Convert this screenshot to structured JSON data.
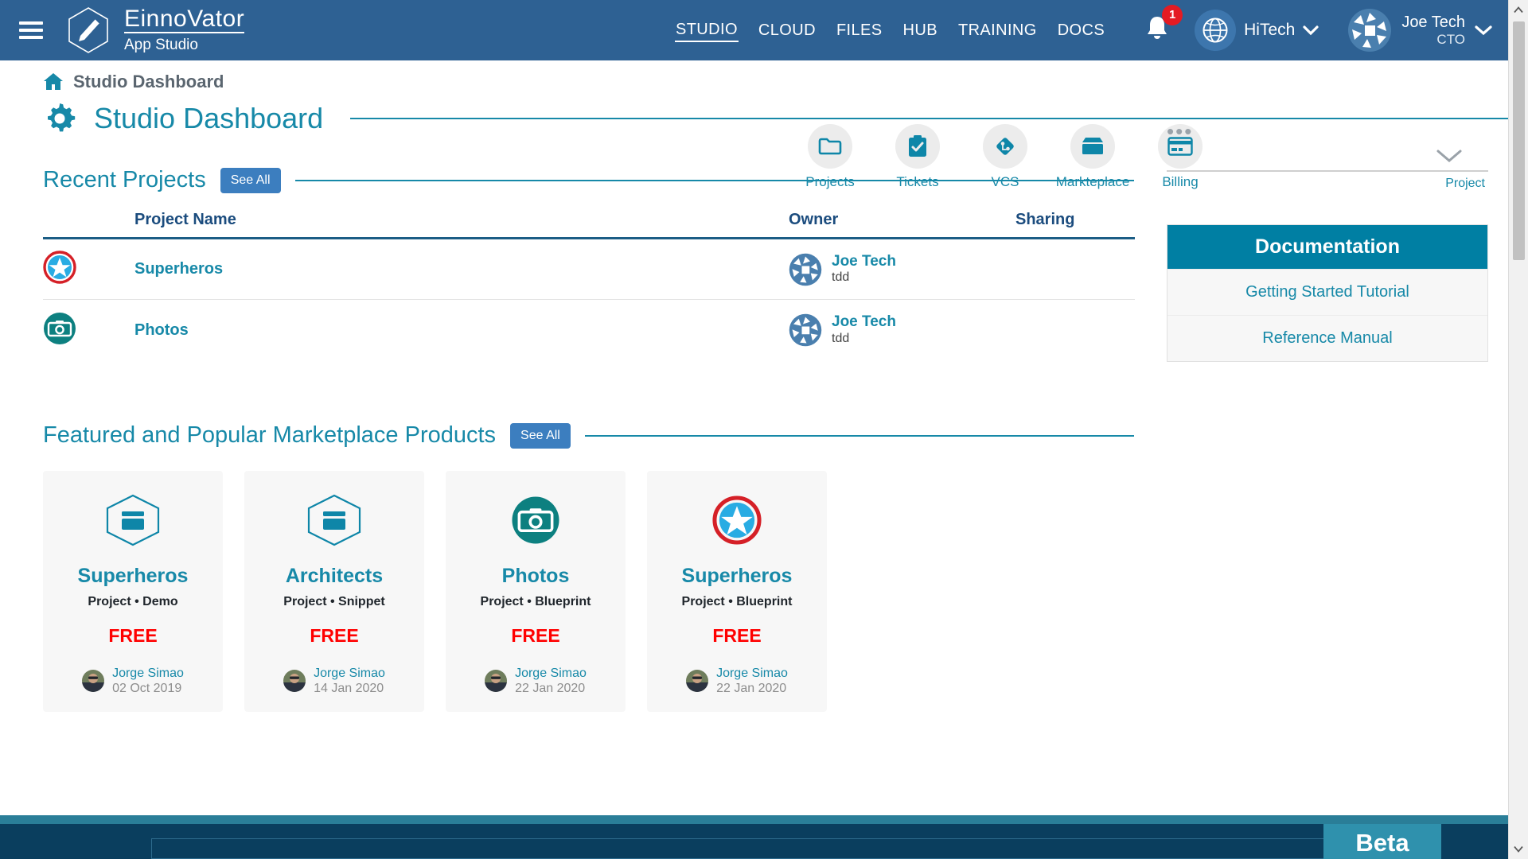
{
  "header": {
    "brand_name": "EinnoVator",
    "brand_sub": "App Studio",
    "nav": [
      {
        "label": "STUDIO",
        "active": true
      },
      {
        "label": "CLOUD",
        "active": false
      },
      {
        "label": "FILES",
        "active": false
      },
      {
        "label": "HUB",
        "active": false
      },
      {
        "label": "TRAINING",
        "active": false
      },
      {
        "label": "DOCS",
        "active": false
      }
    ],
    "notification_count": "1",
    "org_name": "HiTech",
    "user_name": "Joe Tech",
    "user_role": "CTO"
  },
  "breadcrumb": {
    "label": "Studio Dashboard"
  },
  "page": {
    "title": "Studio Dashboard"
  },
  "toolbar": [
    {
      "label": "Projects",
      "icon": "folder-icon"
    },
    {
      "label": "Tickets",
      "icon": "clipboard-check-icon"
    },
    {
      "label": "VCS",
      "icon": "git-branch-icon"
    },
    {
      "label": "Markteplace",
      "icon": "box-icon"
    },
    {
      "label": "Billing",
      "icon": "credit-card-icon"
    }
  ],
  "recent_projects": {
    "title": "Recent Projects",
    "see_all_label": "See All",
    "columns": {
      "icon": "",
      "name": "Project Name",
      "owner": "Owner",
      "sharing": "Sharing"
    },
    "rows": [
      {
        "name": "Superheros",
        "icon": "shield-star-icon",
        "owner_name": "Joe Tech",
        "owner_handle": "tdd",
        "sharing": ""
      },
      {
        "name": "Photos",
        "icon": "camera-icon",
        "owner_name": "Joe Tech",
        "owner_handle": "tdd",
        "sharing": ""
      }
    ]
  },
  "marketplace": {
    "title": "Featured and Popular Marketplace Products",
    "see_all_label": "See All",
    "cards": [
      {
        "title": "Superheros",
        "kind": "Project • Demo",
        "price": "FREE",
        "author": "Jorge Simao",
        "date": "02 Oct 2019",
        "icon": "hexagon-package-icon"
      },
      {
        "title": "Architects",
        "kind": "Project • Snippet",
        "price": "FREE",
        "author": "Jorge Simao",
        "date": "14 Jan 2020",
        "icon": "hexagon-package-icon"
      },
      {
        "title": "Photos",
        "kind": "Project • Blueprint",
        "price": "FREE",
        "author": "Jorge Simao",
        "date": "22 Jan 2020",
        "icon": "camera-icon"
      },
      {
        "title": "Superheros",
        "kind": "Project • Blueprint",
        "price": "FREE",
        "author": "Jorge Simao",
        "date": "22 Jan 2020",
        "icon": "shield-star-icon"
      }
    ]
  },
  "rail": {
    "dots_label": "•••",
    "project_label": "Project",
    "documentation": {
      "title": "Documentation",
      "items": [
        {
          "label": "Getting Started Tutorial"
        },
        {
          "label": "Reference Manual"
        }
      ]
    }
  },
  "footer": {
    "beta_label": "Beta"
  },
  "colors": {
    "header_blue": "#2e6193",
    "accent_teal": "#1789a8",
    "doc_header": "#007fa3",
    "price_red": "#ff0000",
    "badge_red": "#e41b23",
    "button_blue": "#3c7ebf",
    "footer_navy": "#0a3e5e"
  }
}
